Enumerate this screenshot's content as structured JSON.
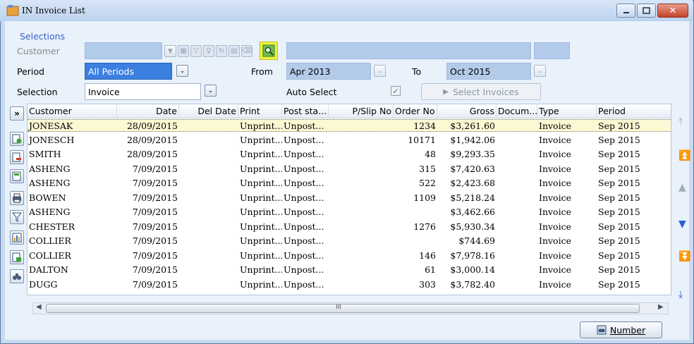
{
  "window": {
    "title": "IN Invoice List",
    "close_glyph": "✕"
  },
  "filters": {
    "selections_label": "Selections",
    "customer_label": "Customer",
    "period_label": "Period",
    "period_value": "All Periods",
    "from_label": "From",
    "from_value": "Apr 2013",
    "to_label": "To",
    "to_value": "Oct 2015",
    "selection_label": "Selection",
    "selection_value": "Invoice",
    "auto_select_label": "Auto Select",
    "auto_select_checked": true,
    "select_invoices_label": "Select Invoices"
  },
  "grid": {
    "expand_glyph": "»",
    "columns": [
      "Customer",
      "Date",
      "Del Date",
      "Print",
      "Post sta...",
      "P/Slip No",
      "Order No",
      "Gross",
      "Docum...",
      "Type",
      "Period"
    ],
    "rows": [
      [
        "JONESAK",
        "28/09/2015",
        "",
        "Unprint...",
        "Unpost...",
        "",
        "1234",
        "$3,261.60",
        "",
        "Invoice",
        "Sep 2015"
      ],
      [
        "JONESCH",
        "28/09/2015",
        "",
        "Unprint...",
        "Unpost...",
        "",
        "10171",
        "$1,942.06",
        "",
        "Invoice",
        "Sep 2015"
      ],
      [
        "SMITH",
        "28/09/2015",
        "",
        "Unprint...",
        "Unpost...",
        "",
        "48",
        "$9,293.35",
        "",
        "Invoice",
        "Sep 2015"
      ],
      [
        "ASHENG",
        "7/09/2015",
        "",
        "Unprint...",
        "Unpost...",
        "",
        "315",
        "$7,420.63",
        "",
        "Invoice",
        "Sep 2015"
      ],
      [
        "ASHENG",
        "7/09/2015",
        "",
        "Unprint...",
        "Unpost...",
        "",
        "522",
        "$2,423.68",
        "",
        "Invoice",
        "Sep 2015"
      ],
      [
        "BOWEN",
        "7/09/2015",
        "",
        "Unprint...",
        "Unpost...",
        "",
        "1109",
        "$5,218.24",
        "",
        "Invoice",
        "Sep 2015"
      ],
      [
        "ASHENG",
        "7/09/2015",
        "",
        "Unprint...",
        "Unpost...",
        "",
        "",
        "$3,462.66",
        "",
        "Invoice",
        "Sep 2015"
      ],
      [
        "CHESTER",
        "7/09/2015",
        "",
        "Unprint...",
        "Unpost...",
        "",
        "1276",
        "$5,930.34",
        "",
        "Invoice",
        "Sep 2015"
      ],
      [
        "COLLIER",
        "7/09/2015",
        "",
        "Unprint...",
        "Unpost...",
        "",
        "",
        "$744.69",
        "",
        "Invoice",
        "Sep 2015"
      ],
      [
        "COLLIER",
        "7/09/2015",
        "",
        "Unprint...",
        "Unpost...",
        "",
        "146",
        "$7,978.16",
        "",
        "Invoice",
        "Sep 2015"
      ],
      [
        "DALTON",
        "7/09/2015",
        "",
        "Unprint...",
        "Unpost...",
        "",
        "61",
        "$3,000.14",
        "",
        "Invoice",
        "Sep 2015"
      ],
      [
        "DUGG",
        "7/09/2015",
        "",
        "Unprint...",
        "Unpost...",
        "",
        "303",
        "$3,782.40",
        "",
        "Invoice",
        "Sep 2015"
      ]
    ],
    "hscroll_grip": "III"
  },
  "footer": {
    "number_button_label": "Number"
  },
  "colors": {
    "accent": "#3b7fe0",
    "link": "#3a5fc8",
    "selected_row": "#fbf8d3",
    "nav_arrow": "#2a5fd0"
  }
}
